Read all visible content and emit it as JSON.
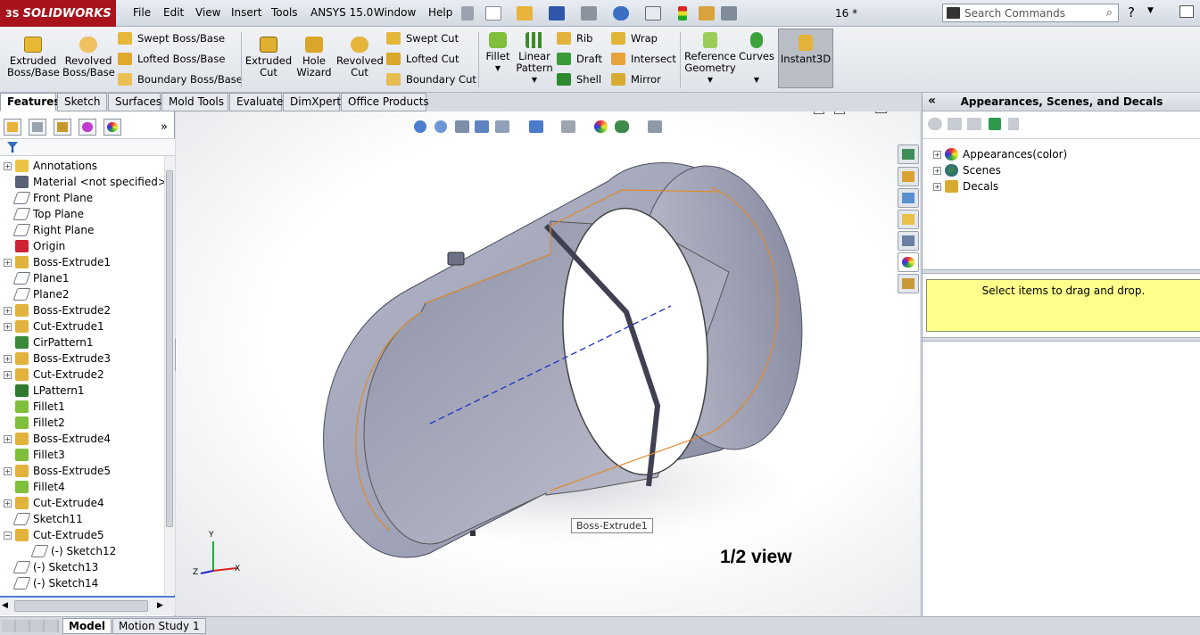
{
  "app": {
    "brand": "SOLIDWORKS",
    "brand_prefix": "3S",
    "doc_title": "16 *"
  },
  "menu": [
    "File",
    "Edit",
    "View",
    "Insert",
    "Tools",
    "ANSYS 15.0",
    "Window",
    "Help"
  ],
  "search": {
    "placeholder": "Search Commands"
  },
  "command_manager": {
    "big_buttons_left": [
      {
        "label1": "Extruded",
        "label2": "Boss/Base"
      },
      {
        "label1": "Revolved",
        "label2": "Boss/Base"
      }
    ],
    "boss_rows": [
      "Swept Boss/Base",
      "Lofted Boss/Base",
      "Boundary Boss/Base"
    ],
    "cut_buttons": [
      {
        "label1": "Extruded",
        "label2": "Cut"
      },
      {
        "label1": "Hole",
        "label2": "Wizard"
      },
      {
        "label1": "Revolved",
        "label2": "Cut"
      }
    ],
    "cut_rows": [
      "Swept Cut",
      "Lofted Cut",
      "Boundary Cut"
    ],
    "fillet": "Fillet",
    "linear_pattern": {
      "label1": "Linear",
      "label2": "Pattern"
    },
    "feature_rows_a": [
      "Rib",
      "Draft",
      "Shell"
    ],
    "feature_rows_b": [
      "Wrap",
      "Intersect",
      "Mirror"
    ],
    "reference_geometry": {
      "label1": "Reference",
      "label2": "Geometry"
    },
    "curves": "Curves",
    "instant3d": "Instant3D"
  },
  "tabs": [
    "Features",
    "Sketch",
    "Surfaces",
    "Mold Tools",
    "Evaluate",
    "DimXpert",
    "Office Products"
  ],
  "tree": [
    {
      "label": "Annotations",
      "expand": true,
      "indent": 0
    },
    {
      "label": "Material <not specified>",
      "expand": false,
      "indent": 0
    },
    {
      "label": "Front Plane",
      "expand": false,
      "indent": 0
    },
    {
      "label": "Top Plane",
      "expand": false,
      "indent": 0
    },
    {
      "label": "Right Plane",
      "expand": false,
      "indent": 0
    },
    {
      "label": "Origin",
      "expand": false,
      "indent": 0
    },
    {
      "label": "Boss-Extrude1",
      "expand": true,
      "indent": 0
    },
    {
      "label": "Plane1",
      "expand": false,
      "indent": 0
    },
    {
      "label": "Plane2",
      "expand": false,
      "indent": 0
    },
    {
      "label": "Boss-Extrude2",
      "expand": true,
      "indent": 0
    },
    {
      "label": "Cut-Extrude1",
      "expand": true,
      "indent": 0
    },
    {
      "label": "CirPattern1",
      "expand": false,
      "indent": 0
    },
    {
      "label": "Boss-Extrude3",
      "expand": true,
      "indent": 0
    },
    {
      "label": "Cut-Extrude2",
      "expand": true,
      "indent": 0
    },
    {
      "label": "LPattern1",
      "expand": false,
      "indent": 0
    },
    {
      "label": "Fillet1",
      "expand": false,
      "indent": 0
    },
    {
      "label": "Fillet2",
      "expand": false,
      "indent": 0
    },
    {
      "label": "Boss-Extrude4",
      "expand": true,
      "indent": 0
    },
    {
      "label": "Fillet3",
      "expand": false,
      "indent": 0
    },
    {
      "label": "Boss-Extrude5",
      "expand": true,
      "indent": 0
    },
    {
      "label": "Fillet4",
      "expand": false,
      "indent": 0
    },
    {
      "label": "Cut-Extrude4",
      "expand": true,
      "indent": 0
    },
    {
      "label": "Sketch11",
      "expand": false,
      "indent": 0
    },
    {
      "label": "Cut-Extrude5",
      "expand": "open",
      "indent": 0
    },
    {
      "label": "(-) Sketch12",
      "expand": false,
      "indent": 1
    },
    {
      "label": "(-) Sketch13",
      "expand": false,
      "indent": 0
    },
    {
      "label": "(-) Sketch14",
      "expand": false,
      "indent": 0
    }
  ],
  "viewport": {
    "tooltip": "Boss-Extrude1",
    "annotation": "1/2 view",
    "axes": {
      "x": "X",
      "y": "Y",
      "z": "Z"
    }
  },
  "task_pane": {
    "title": "Appearances, Scenes, and Decals",
    "items": [
      "Appearances(color)",
      "Scenes",
      "Decals"
    ],
    "drop_hint": "Select items to drag and drop."
  },
  "bottom_tabs": [
    "Model",
    "Motion Study 1"
  ],
  "colors": {
    "brand_red": "#a8131c",
    "hint_yellow": "#ffff8c",
    "edge_orange": "#e08a2a",
    "axis_blue": "#1e2fc8"
  }
}
